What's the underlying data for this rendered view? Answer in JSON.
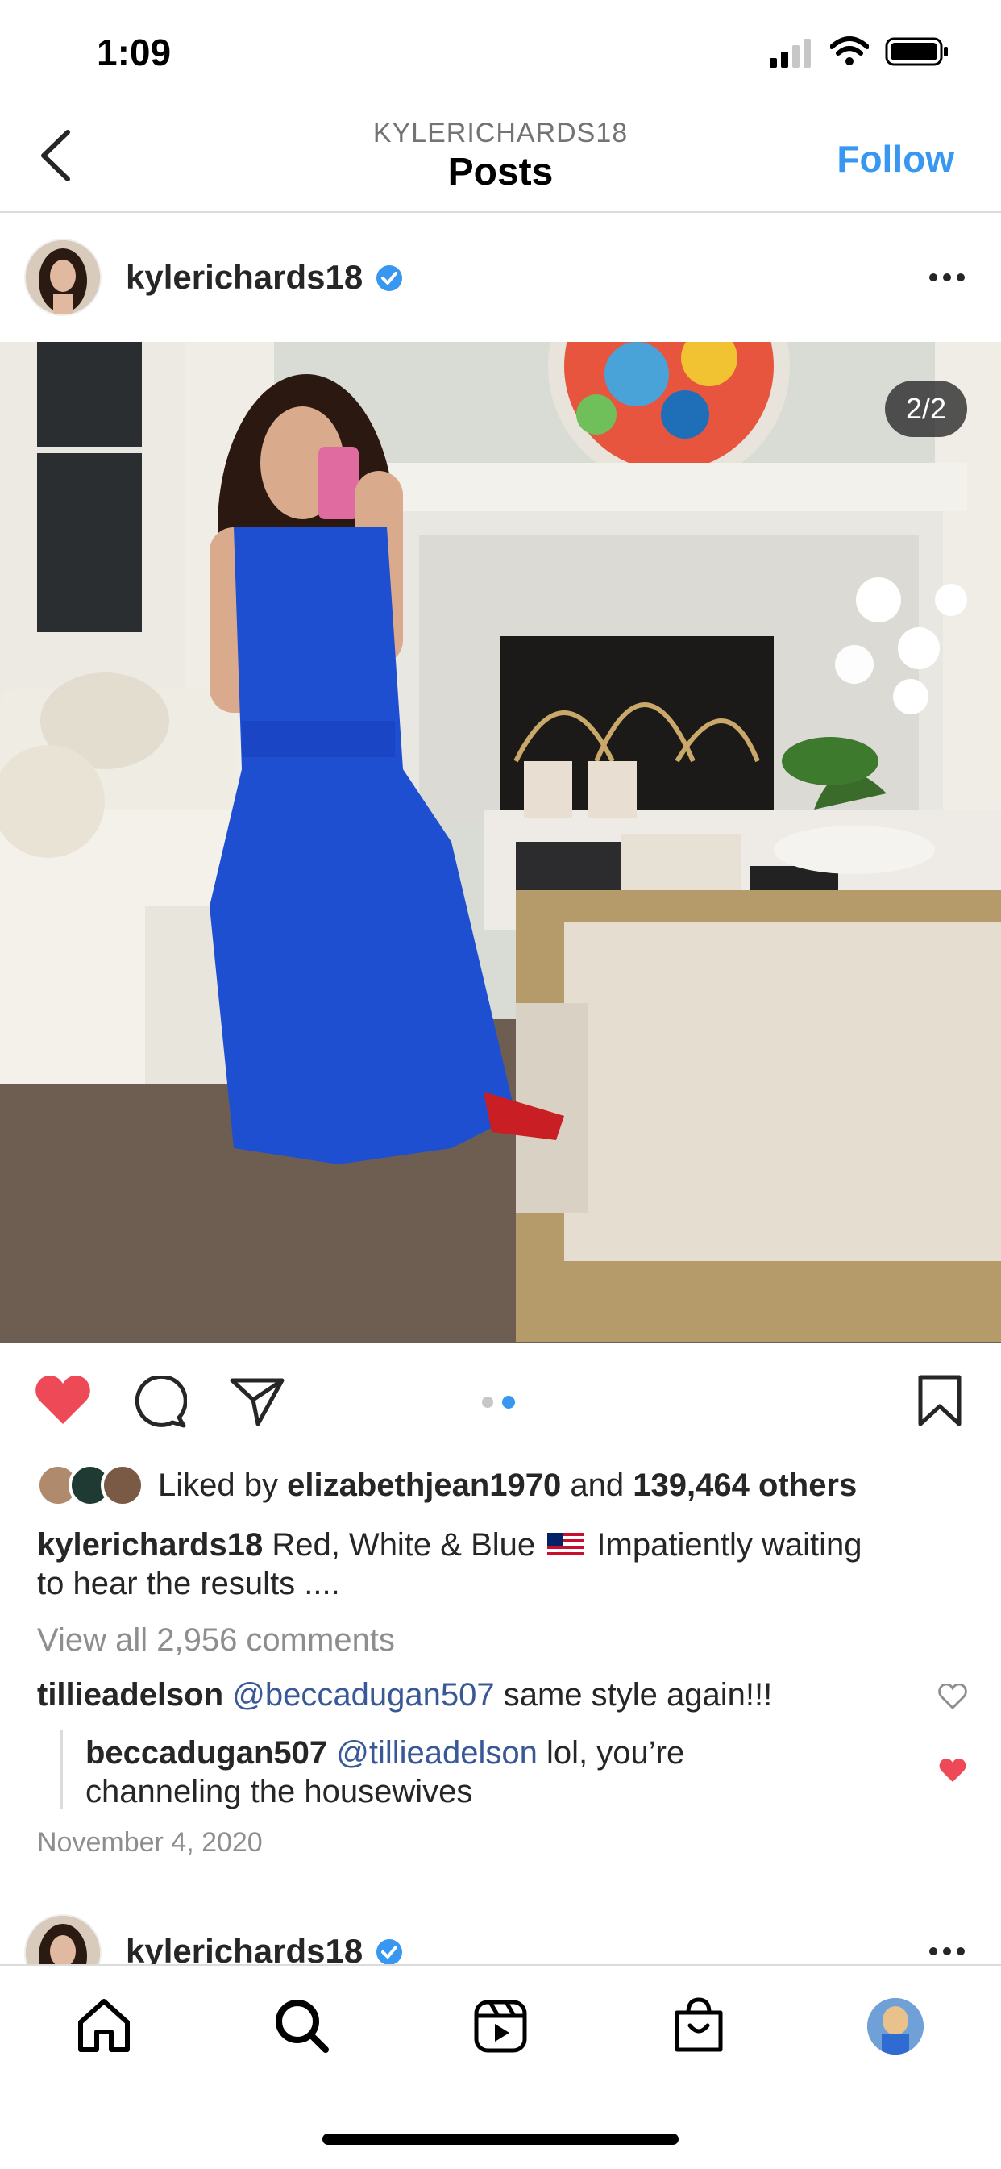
{
  "status_bar": {
    "time": "1:09"
  },
  "nav": {
    "subtitle": "KYLERICHARDS18",
    "title": "Posts",
    "follow_label": "Follow"
  },
  "post": {
    "username": "kylerichards18",
    "image_counter": "2/2",
    "likes": {
      "liked_by_prefix": "Liked by",
      "liked_by_user": "elizabethjean1970",
      "and": "and",
      "others": "139,464 others"
    },
    "caption": {
      "user": "kylerichards18",
      "text_before_flag": "Red, White & Blue",
      "text_after_flag": "Impatiently waiting",
      "text_line2": "to hear the results ...."
    },
    "view_all_comments": "View all 2,956 comments",
    "comments": [
      {
        "user": "tillieadelson",
        "mention": "@beccadugan507",
        "text": "same style again!!!"
      },
      {
        "user": "beccadugan507",
        "mention": "@tillieadelson",
        "text": "lol, you’re",
        "text_line2": "channeling the housewives"
      }
    ],
    "date": "November 4, 2020"
  },
  "next_post": {
    "username": "kylerichards18"
  },
  "colors": {
    "accent": "#3897f0",
    "like_red": "#ed4956",
    "dress_blue": "#1f4fd1"
  },
  "icons": [
    "back-chevron-icon",
    "verified-badge-icon",
    "more-icon",
    "heart-icon",
    "comment-icon",
    "share-icon",
    "bookmark-icon",
    "home-icon",
    "search-icon",
    "reels-icon",
    "shop-icon"
  ]
}
